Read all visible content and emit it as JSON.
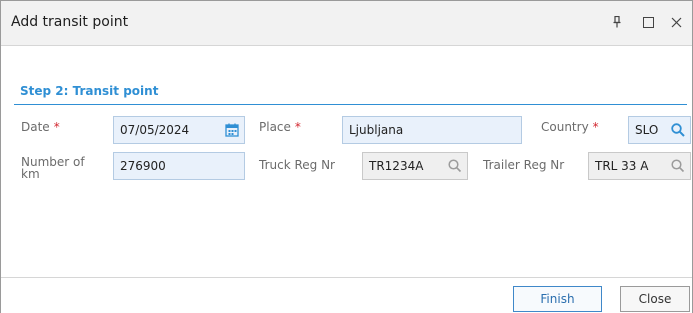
{
  "window": {
    "title": "Add transit point",
    "controls": {
      "pin": "pin-icon",
      "maximize": "maximize-icon",
      "close": "close-icon"
    }
  },
  "step": {
    "title": "Step 2: Transit point"
  },
  "form": {
    "date": {
      "label": "Date",
      "required": "*",
      "value": "07/05/2024",
      "icon": "calendar-icon"
    },
    "place": {
      "label": "Place",
      "required": "*",
      "value": "Ljubljana"
    },
    "country": {
      "label": "Country",
      "required": "*",
      "value": "SLO",
      "icon": "search-icon"
    },
    "number_of_km": {
      "label_line1": "Number of",
      "label_line2": "km",
      "value": "276900"
    },
    "truck_reg_nr": {
      "label": "Truck Reg Nr",
      "value": "TR1234A",
      "icon": "search-icon"
    },
    "trailer_reg_nr": {
      "label": "Trailer Reg Nr",
      "value": "TRL 33 A",
      "icon": "search-icon"
    }
  },
  "footer": {
    "finish_label": "Finish",
    "close_label": "Close"
  },
  "colors": {
    "accent": "#2f8fd4",
    "required": "#d2262e",
    "field_bg": "#e9f1fb",
    "readonly_bg": "#efefef"
  }
}
